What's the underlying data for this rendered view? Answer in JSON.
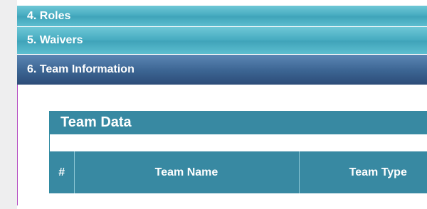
{
  "accordion": {
    "sections": [
      {
        "label": "4. Roles"
      },
      {
        "label": "5. Waivers"
      },
      {
        "label": "6. Team Information"
      }
    ]
  },
  "team_panel": {
    "title": "Team Data",
    "columns": [
      "#",
      "Team Name",
      "Team Type"
    ]
  },
  "colors": {
    "accordion_teal": "#46abc0",
    "accordion_active": "#3b6492",
    "table_header": "#3889a2",
    "body_border": "#b54ec3"
  }
}
